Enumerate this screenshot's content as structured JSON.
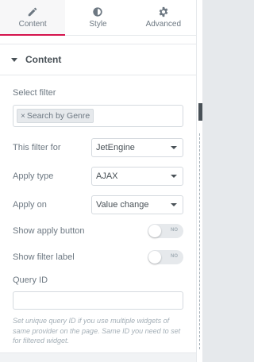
{
  "tabs": [
    {
      "label": "Content",
      "icon": "pencil-icon",
      "active": true
    },
    {
      "label": "Style",
      "icon": "half-circle-icon",
      "active": false
    },
    {
      "label": "Advanced",
      "icon": "gear-icon",
      "active": false
    }
  ],
  "section": {
    "title": "Content"
  },
  "select_filter": {
    "label": "Select filter",
    "chip": "Search by Genre",
    "chip_remove": "×"
  },
  "this_filter_for": {
    "label": "This filter for",
    "value": "JetEngine"
  },
  "apply_type": {
    "label": "Apply type",
    "value": "AJAX"
  },
  "apply_on": {
    "label": "Apply on",
    "value": "Value change"
  },
  "show_apply_button": {
    "label": "Show apply button",
    "toggle": "NO"
  },
  "show_filter_label": {
    "label": "Show filter label",
    "toggle": "NO"
  },
  "query_id": {
    "label": "Query ID",
    "value": "",
    "description": "Set unique query ID if you use multiple widgets of same provider on the page. Same ID you need to set for filtered widget."
  },
  "colors": {
    "accent": "#d5144d"
  }
}
